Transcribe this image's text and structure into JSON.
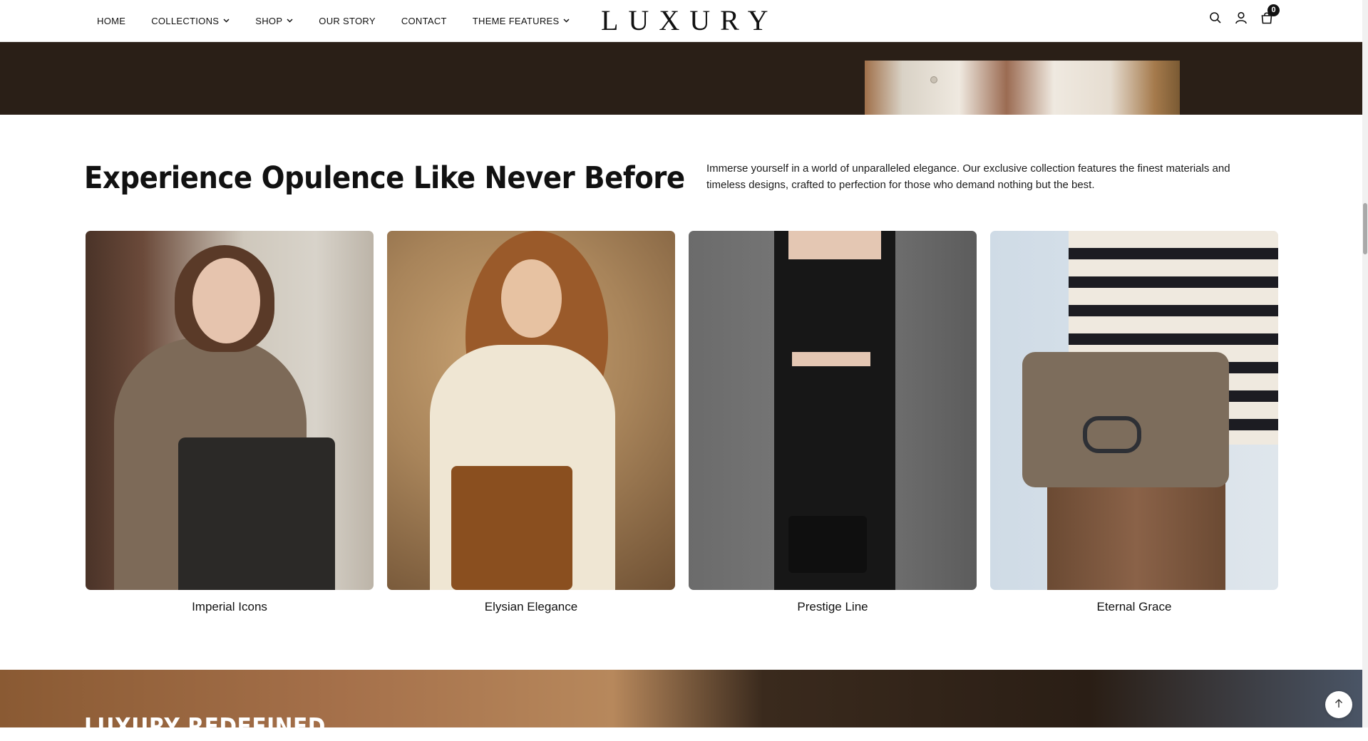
{
  "nav": {
    "items": [
      {
        "label": "HOME",
        "has_dropdown": false
      },
      {
        "label": "COLLECTIONS",
        "has_dropdown": true
      },
      {
        "label": "SHOP",
        "has_dropdown": true
      },
      {
        "label": "OUR STORY",
        "has_dropdown": false
      },
      {
        "label": "CONTACT",
        "has_dropdown": false
      },
      {
        "label": "THEME FEATURES",
        "has_dropdown": true
      }
    ]
  },
  "brand": {
    "logo": "LUXURY"
  },
  "header_icons": {
    "search": "search-icon",
    "account": "user-icon",
    "cart": "bag-icon",
    "cart_count": "0"
  },
  "section": {
    "title": "Experience Opulence Like Never Before",
    "description": "Immerse yourself in a world of unparalleled elegance. Our exclusive collection features the finest materials and timeless designs, crafted to perfection for those who demand nothing but the best."
  },
  "collections": [
    {
      "label": "Imperial Icons"
    },
    {
      "label": "Elysian Elegance"
    },
    {
      "label": "Prestige Line"
    },
    {
      "label": "Eternal Grace"
    }
  ],
  "next_section": {
    "title": "LUXURY REDEFINED"
  },
  "colors": {
    "header_bg": "#ffffff",
    "dark_band": "#2a1f17",
    "text": "#111111"
  }
}
